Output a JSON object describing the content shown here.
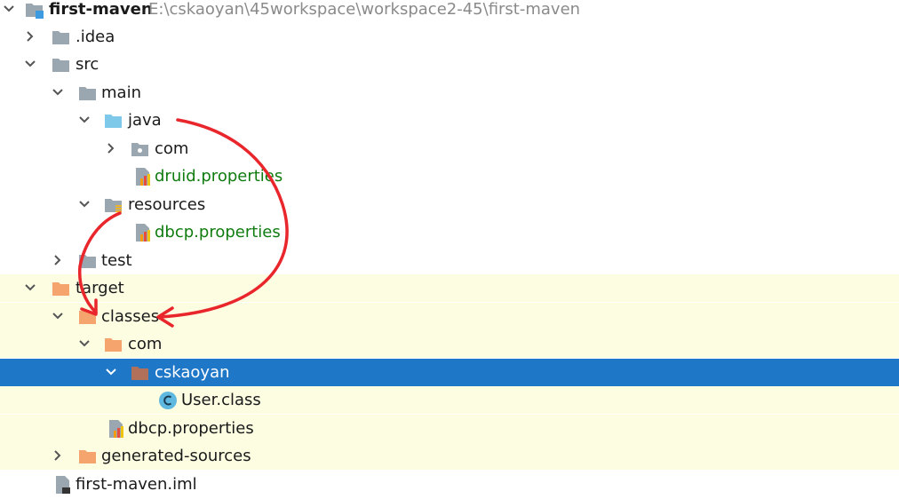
{
  "project": {
    "name": "first-maven",
    "path": "E:\\cskaoyan\\45workspace\\workspace2-45\\first-maven"
  },
  "tree": {
    "idea": ".idea",
    "src": "src",
    "main": "main",
    "java": "java",
    "com_src": "com",
    "druid": "druid.properties",
    "resources": "resources",
    "dbcp_src": "dbcp.properties",
    "test": "test",
    "target": "target",
    "classes": "classes",
    "com_target": "com",
    "cskaoyan": "cskaoyan",
    "user_class": "User.class",
    "dbcp_target": "dbcp.properties",
    "generated": "generated-sources",
    "iml": "first-maven.iml"
  },
  "colors": {
    "excluded_bg": "#fdfde2",
    "selected_bg": "#1f77c8",
    "resource_text": "#107c10",
    "annotation": "#e8262b"
  }
}
